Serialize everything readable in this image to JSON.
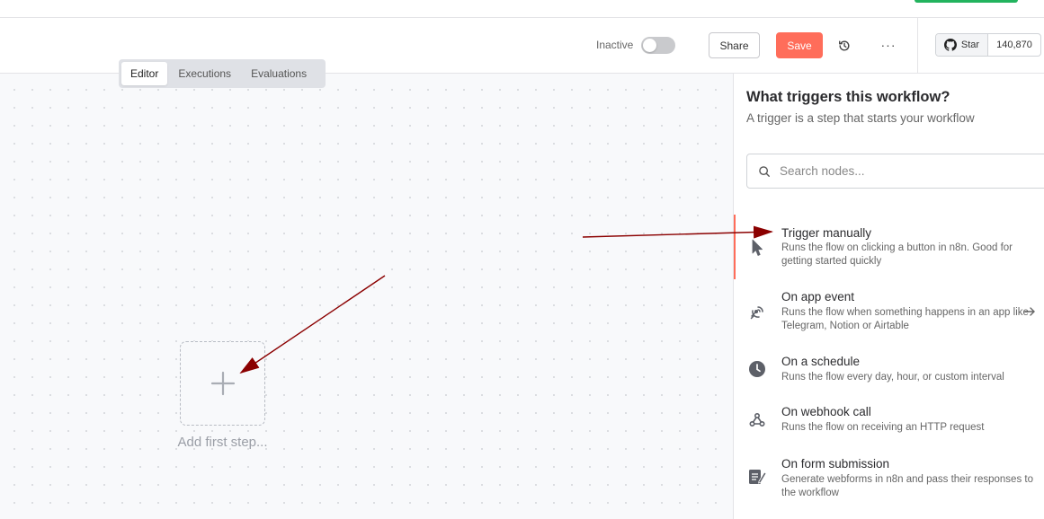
{
  "header": {
    "status_label": "Inactive",
    "share_label": "Share",
    "save_label": "Save",
    "more_label": "···",
    "github": {
      "star_label": "Star",
      "star_count": "140,870"
    }
  },
  "tabs": [
    {
      "label": "Editor",
      "active": true
    },
    {
      "label": "Executions",
      "active": false
    },
    {
      "label": "Evaluations",
      "active": false
    }
  ],
  "canvas": {
    "add_step_label": "Add first step..."
  },
  "panel": {
    "title": "What triggers this workflow?",
    "subtitle": "A trigger is a step that starts your workflow",
    "search_placeholder": "Search nodes...",
    "items": [
      {
        "name": "Trigger manually",
        "desc": "Runs the flow on clicking a button in n8n. Good for getting started quickly",
        "icon": "cursor-icon"
      },
      {
        "name": "On app event",
        "desc": "Runs the flow when something happens in an app like Telegram, Notion or Airtable",
        "icon": "satellite-icon"
      },
      {
        "name": "On a schedule",
        "desc": "Runs the flow every day, hour, or custom interval",
        "icon": "clock-icon"
      },
      {
        "name": "On webhook call",
        "desc": "Runs the flow on receiving an HTTP request",
        "icon": "webhook-icon"
      },
      {
        "name": "On form submission",
        "desc": "Generate webforms in n8n and pass their responses to the workflow",
        "icon": "form-icon"
      }
    ]
  },
  "colors": {
    "save_button": "#ff6d5a",
    "annotation_arrow": "#8b0000",
    "active_bar": "#ff6d5a"
  }
}
